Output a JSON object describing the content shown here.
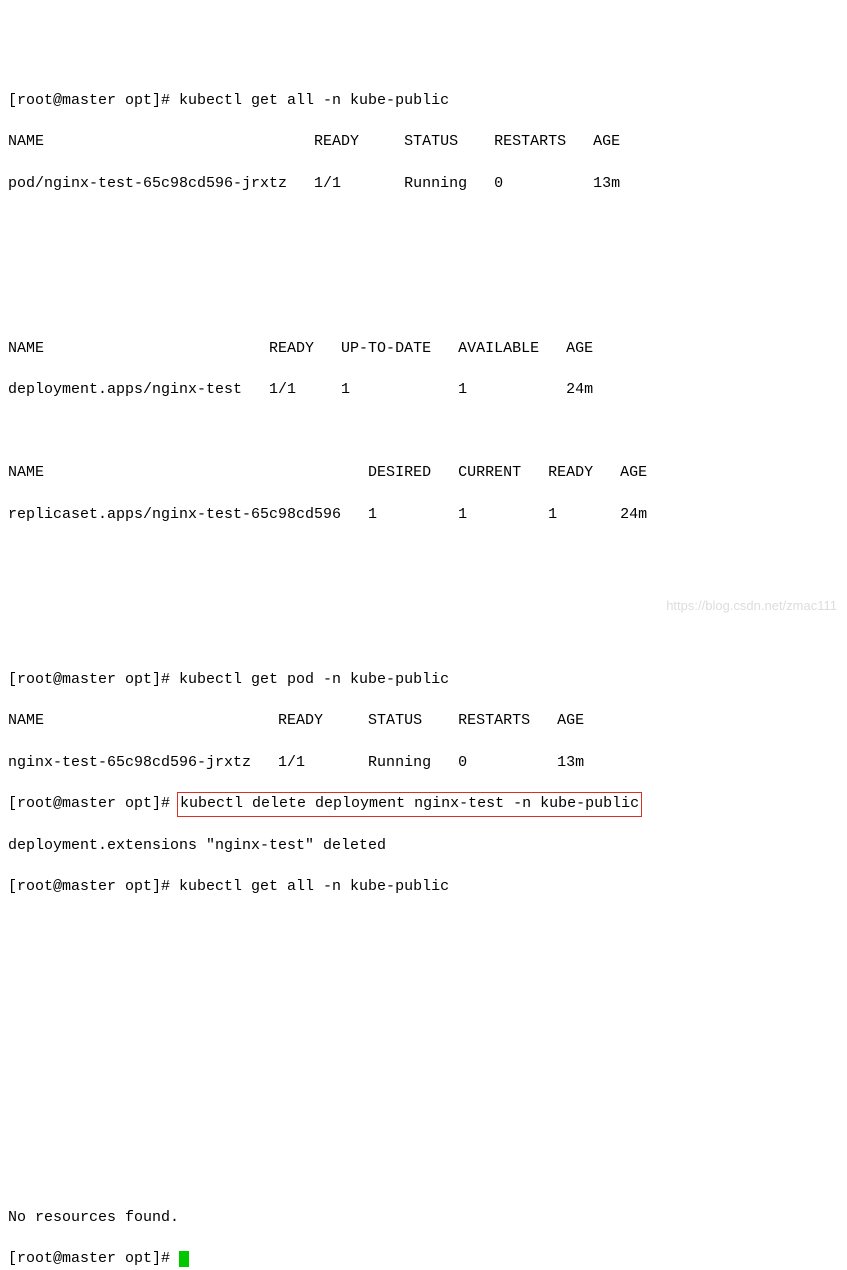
{
  "prompt1": "[root@master opt]# kubectl get all -n kube-public",
  "hdr1": "NAME                              READY     STATUS    RESTARTS   AGE",
  "row1": "pod/nginx-test-65c98cd596-jrxtz   1/1       Running   0          13m",
  "hdr2": "NAME                         READY   UP-TO-DATE   AVAILABLE   AGE",
  "row2": "deployment.apps/nginx-test   1/1     1            1           24m",
  "hdr3": "NAME                                    DESIRED   CURRENT   READY   AGE",
  "row3": "replicaset.apps/nginx-test-65c98cd596   1         1         1       24m",
  "prompt2": "[root@master opt]# kubectl get pod -n kube-public",
  "hdr4": "NAME                          READY     STATUS    RESTARTS   AGE",
  "row4": "nginx-test-65c98cd596-jrxtz   1/1       Running   0          13m",
  "prompt3a": "[root@master opt]# ",
  "cmd3": "kubectl delete deployment nginx-test -n kube-public",
  "out3": "deployment.extensions \"nginx-test\" deleted",
  "prompt4": "[root@master opt]# kubectl get all -n kube-public",
  "noresources": "No resources found.",
  "prompt5": "[root@master opt]# ",
  "watermark": "https://blog.csdn.net/zmac111"
}
